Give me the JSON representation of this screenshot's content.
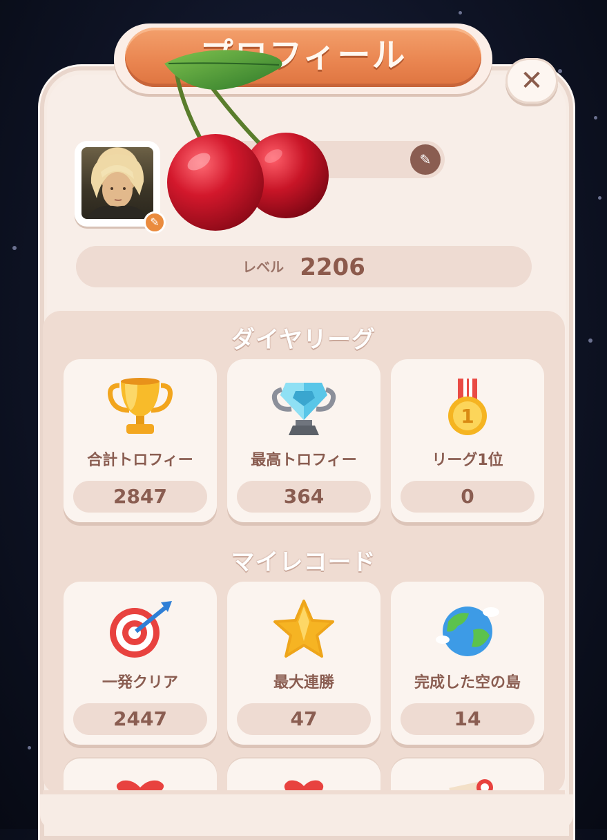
{
  "header": {
    "title": "プロフィール",
    "close_icon": "close-icon"
  },
  "profile": {
    "avatar_edit_icon": "pencil-icon",
    "name": "",
    "name_edit_icon": "pencil-icon",
    "level_label": "レベル",
    "level_value": "2206"
  },
  "league": {
    "title": "ダイヤリーグ",
    "cards": [
      {
        "label": "合計トロフィー",
        "value": "2847",
        "icon": "gold-trophy-icon"
      },
      {
        "label": "最高トロフィー",
        "value": "364",
        "icon": "diamond-trophy-icon"
      },
      {
        "label": "リーグ1位",
        "value": "0",
        "icon": "medal-icon"
      }
    ]
  },
  "records": {
    "title": "マイレコード",
    "cards": [
      {
        "label": "一発クリア",
        "value": "2447",
        "icon": "target-icon"
      },
      {
        "label": "最大連勝",
        "value": "47",
        "icon": "star-icon"
      },
      {
        "label": "完成した空の島",
        "value": "14",
        "icon": "globe-icon"
      }
    ],
    "partial_cards": [
      {
        "icon": "heart-icon"
      },
      {
        "icon": "heart-icon"
      },
      {
        "icon": "gift-icon"
      }
    ]
  },
  "overlay": {
    "icon": "cherry-sticker",
    "colors": {
      "cherry": "#d3182c",
      "leaf": "#4f9a3a"
    }
  },
  "colors": {
    "panel": "#f7ece5",
    "banner": "#e9844f",
    "text_brown": "#8a5d51"
  }
}
